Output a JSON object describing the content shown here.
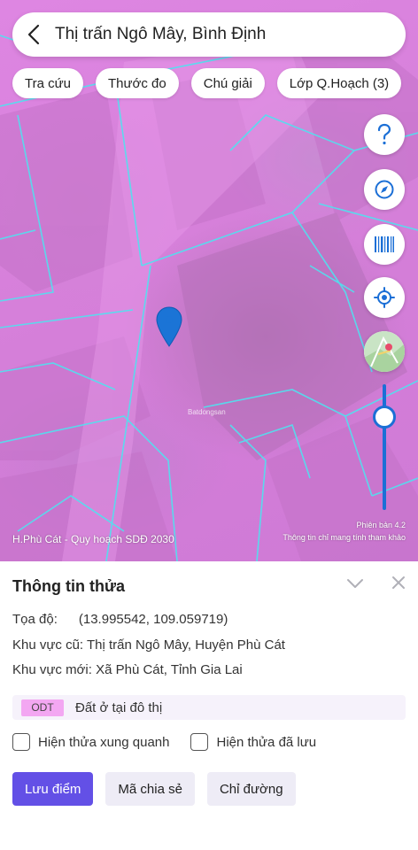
{
  "search": {
    "title": "Thị trấn Ngô Mây, Bình Định"
  },
  "chips": [
    "Tra cứu",
    "Thước đo",
    "Chú giải",
    "Lớp Q.Hoạch (3)"
  ],
  "map": {
    "source_label": "H.Phù Cát - Quy hoạch SDĐ 2030",
    "version": "Phiên bản 4.2",
    "disclaimer": "Thông tin chỉ mang tính tham khảo",
    "zoom_level": 0.83,
    "overlay_color": "#df86e3",
    "boundary_color": "#4fe3f0",
    "pin_color": "#1b74d6"
  },
  "panel": {
    "title": "Thông tin thửa",
    "coord_label": "Tọa độ:",
    "coord_value": "(13.995542, 109.059719)",
    "old_area_label": "Khu vực cũ:",
    "old_area_value": "Thị trấn Ngô Mây, Huyện Phù Cát",
    "new_area_label": "Khu vực mới:",
    "new_area_value": "Xã Phù Cát, Tỉnh Gia Lai",
    "landuse_code": "ODT",
    "landuse_desc": "Đất ở tại đô thị",
    "checkbox_nearby": "Hiện thửa xung quanh",
    "checkbox_saved": "Hiện thửa đã lưu",
    "btn_save": "Lưu điểm",
    "btn_share": "Mã chia sẻ",
    "btn_directions": "Chỉ đường"
  },
  "colors": {
    "accent": "#6350e6",
    "zoom": "#1b6fd6",
    "landuse_badge": "#f3a7f2"
  }
}
